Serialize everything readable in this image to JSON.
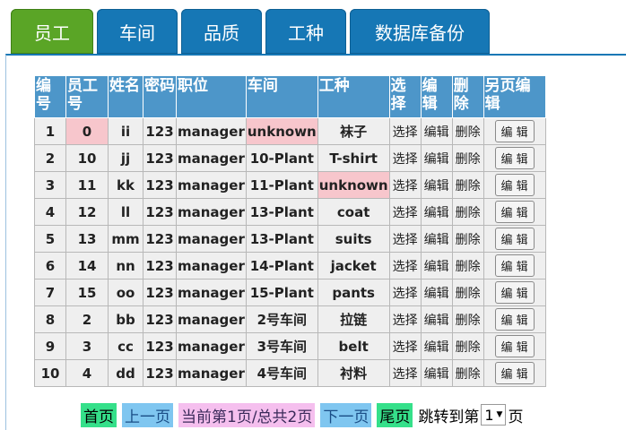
{
  "tabs": [
    {
      "label": "员工",
      "active": true
    },
    {
      "label": "车间",
      "active": false
    },
    {
      "label": "品质",
      "active": false
    },
    {
      "label": "工种",
      "active": false
    },
    {
      "label": "数据库备份",
      "active": false
    }
  ],
  "table": {
    "headers": [
      "编号",
      "员工号",
      "姓名",
      "密码",
      "职位",
      "车间",
      "工种",
      "选择",
      "编辑",
      "删除",
      "另页编辑"
    ],
    "rows": [
      {
        "id": "1",
        "emp": "0",
        "name": "ii",
        "pwd": "123",
        "pos": "manager",
        "workshop": "unknown",
        "type": "袜子",
        "select": "选择",
        "edit": "编辑",
        "delete": "删除",
        "edit2": "编 辑"
      },
      {
        "id": "2",
        "emp": "10",
        "name": "jj",
        "pwd": "123",
        "pos": "manager",
        "workshop": "10-Plant",
        "type": "T-shirt",
        "select": "选择",
        "edit": "编辑",
        "delete": "删除",
        "edit2": "编 辑"
      },
      {
        "id": "3",
        "emp": "11",
        "name": "kk",
        "pwd": "123",
        "pos": "manager",
        "workshop": "11-Plant",
        "type": "unknown",
        "select": "选择",
        "edit": "编辑",
        "delete": "删除",
        "edit2": "编 辑"
      },
      {
        "id": "4",
        "emp": "12",
        "name": "ll",
        "pwd": "123",
        "pos": "manager",
        "workshop": "13-Plant",
        "type": "coat",
        "select": "选择",
        "edit": "编辑",
        "delete": "删除",
        "edit2": "编 辑"
      },
      {
        "id": "5",
        "emp": "13",
        "name": "mm",
        "pwd": "123",
        "pos": "manager",
        "workshop": "13-Plant",
        "type": "suits",
        "select": "选择",
        "edit": "编辑",
        "delete": "删除",
        "edit2": "编 辑"
      },
      {
        "id": "6",
        "emp": "14",
        "name": "nn",
        "pwd": "123",
        "pos": "manager",
        "workshop": "14-Plant",
        "type": "jacket",
        "select": "选择",
        "edit": "编辑",
        "delete": "删除",
        "edit2": "编 辑"
      },
      {
        "id": "7",
        "emp": "15",
        "name": "oo",
        "pwd": "123",
        "pos": "manager",
        "workshop": "15-Plant",
        "type": "pants",
        "select": "选择",
        "edit": "编辑",
        "delete": "删除",
        "edit2": "编 辑"
      },
      {
        "id": "8",
        "emp": "2",
        "name": "bb",
        "pwd": "123",
        "pos": "manager",
        "workshop": "2号车间",
        "type": "拉链",
        "select": "选择",
        "edit": "编辑",
        "delete": "删除",
        "edit2": "编 辑"
      },
      {
        "id": "9",
        "emp": "3",
        "name": "cc",
        "pwd": "123",
        "pos": "manager",
        "workshop": "3号车间",
        "type": "belt",
        "select": "选择",
        "edit": "编辑",
        "delete": "删除",
        "edit2": "编 辑"
      },
      {
        "id": "10",
        "emp": "4",
        "name": "dd",
        "pwd": "123",
        "pos": "manager",
        "workshop": "4号车间",
        "type": "衬料",
        "select": "选择",
        "edit": "编辑",
        "delete": "删除",
        "edit2": "编 辑"
      }
    ]
  },
  "pager": {
    "first": "首页",
    "prev": "上一页",
    "current": "当前第1页/总共2页",
    "next": "下一页",
    "last": "尾页",
    "jump_label": "跳转到第",
    "jump_value": "1",
    "jump_suffix": "页"
  },
  "colors": {
    "tab_blue": "#1677b5",
    "tab_active_green": "#5aa526",
    "header_blue": "#4d96c9",
    "highlight_pink": "#f7c6cc"
  }
}
